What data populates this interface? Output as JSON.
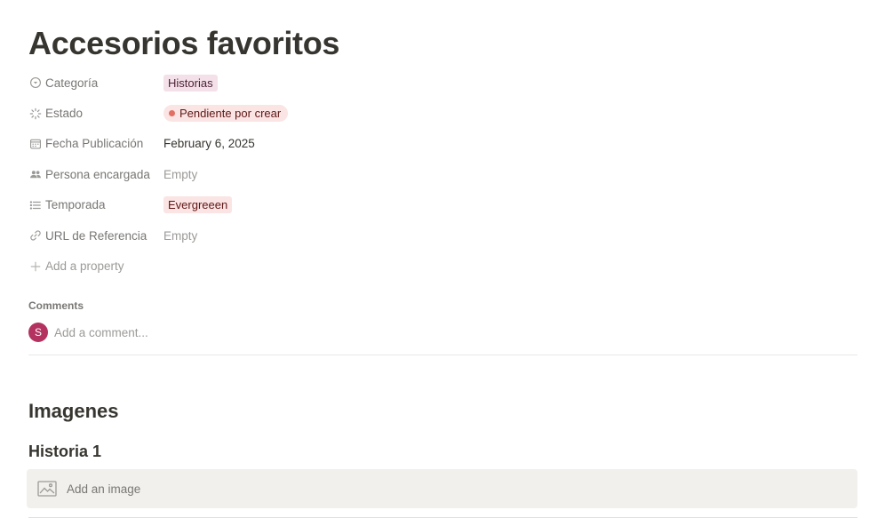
{
  "page": {
    "title": "Accesorios favoritos"
  },
  "properties": [
    {
      "label": "Categoría",
      "icon": "select-circle-icon",
      "value": "Historias",
      "kind": "tag",
      "tag_color": "#f4e0e9"
    },
    {
      "label": "Estado",
      "icon": "status-spinner-icon",
      "value": "Pendiente por crear",
      "kind": "status",
      "status_color": "#e16f64"
    },
    {
      "label": "Fecha Publicación",
      "icon": "calendar-icon",
      "value": "February 6, 2025",
      "kind": "text"
    },
    {
      "label": "Persona encargada",
      "icon": "people-icon",
      "value": "Empty",
      "kind": "empty"
    },
    {
      "label": "Temporada",
      "icon": "list-icon",
      "value": "Evergreeen",
      "kind": "tag",
      "tag_color": "#fbe4e4"
    },
    {
      "label": "URL de Referencia",
      "icon": "link-icon",
      "value": "Empty",
      "kind": "empty"
    }
  ],
  "add_property_label": "Add a property",
  "comments": {
    "label": "Comments",
    "avatar_initial": "S",
    "avatar_color": "#b3325f",
    "placeholder": "Add a comment..."
  },
  "content": {
    "heading": "Imagenes",
    "subheading": "Historia 1",
    "image_placeholder": "Add an image"
  }
}
